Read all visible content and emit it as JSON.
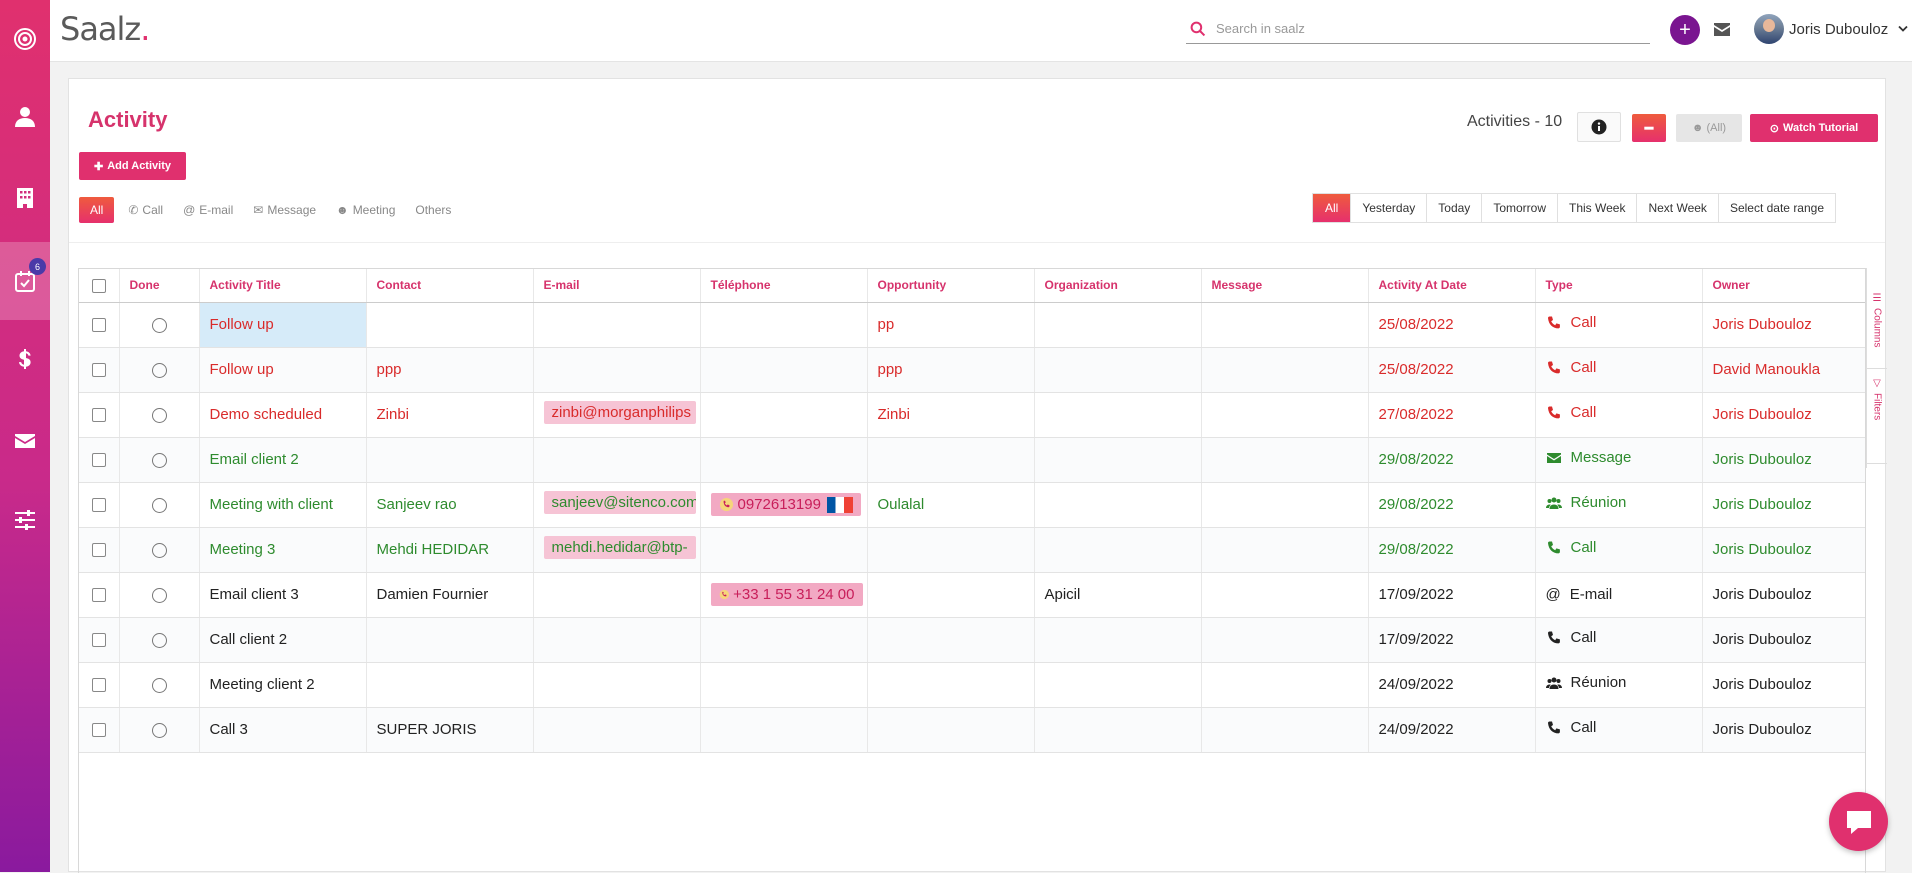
{
  "app": {
    "logo_prefix": "S",
    "logo_middle": "aalz",
    "logo_dot": "."
  },
  "sidebar": {
    "items": [
      {
        "icon": "target-icon"
      },
      {
        "icon": "user-icon"
      },
      {
        "icon": "building-icon"
      },
      {
        "icon": "calendar-check-icon",
        "badge": "6"
      },
      {
        "icon": "dollar-icon"
      },
      {
        "icon": "envelope-icon"
      },
      {
        "icon": "sliders-icon"
      }
    ]
  },
  "header": {
    "search_placeholder": "Search in saalz",
    "plus_label": "+",
    "user_name": "Joris Dubouloz"
  },
  "page": {
    "title": "Activity",
    "add_button": "Add Activity",
    "count_label": "Activities - 10",
    "owner_filter_label": "(All)",
    "tutorial_button": "Watch Tutorial"
  },
  "type_filters": [
    {
      "label": "All",
      "icon": ""
    },
    {
      "label": "Call",
      "icon": "phone-icon"
    },
    {
      "label": "E-mail",
      "icon": "at-icon"
    },
    {
      "label": "Message",
      "icon": "envelope-icon"
    },
    {
      "label": "Meeting",
      "icon": "users-icon"
    },
    {
      "label": "Others",
      "icon": ""
    }
  ],
  "date_filters": [
    "All",
    "Yesterday",
    "Today",
    "Tomorrow",
    "This Week",
    "Next Week",
    "Select date range"
  ],
  "table": {
    "columns": [
      "Done",
      "Activity Title",
      "Contact",
      "E-mail",
      "Téléphone",
      "Opportunity",
      "Organization",
      "Message",
      "Activity At Date",
      "Type",
      "Owner"
    ],
    "rows": [
      {
        "title": "Follow up",
        "contact": "",
        "email": "",
        "phone": "",
        "opportunity": "pp",
        "organization": "",
        "message": "",
        "date": "25/08/2022",
        "type": "Call",
        "owner": "Joris Dubouloz"
      },
      {
        "title": "Follow up",
        "contact": "ppp",
        "email": "",
        "phone": "",
        "opportunity": "ppp",
        "organization": "",
        "message": "",
        "date": "25/08/2022",
        "type": "Call",
        "owner": "David Manoukla"
      },
      {
        "title": "Demo scheduled",
        "contact": "Zinbi",
        "email": "zinbi@morganphilips",
        "phone": "",
        "opportunity": "Zinbi",
        "organization": "",
        "message": "",
        "date": "27/08/2022",
        "type": "Call",
        "owner": "Joris Dubouloz"
      },
      {
        "title": "Email client 2",
        "contact": "",
        "email": "",
        "phone": "",
        "opportunity": "",
        "organization": "",
        "message": "",
        "date": "29/08/2022",
        "type": "Message",
        "owner": "Joris Dubouloz"
      },
      {
        "title": "Meeting with client",
        "contact": "Sanjeev rao",
        "email": "sanjeev@sitenco.com",
        "phone": "0972613199",
        "opportunity": "Oulalal",
        "organization": "",
        "message": "",
        "date": "29/08/2022",
        "type": "Réunion",
        "owner": "Joris Dubouloz"
      },
      {
        "title": "Meeting 3",
        "contact": "Mehdi HEDIDAR",
        "email": "mehdi.hedidar@btp-",
        "phone": "",
        "opportunity": "",
        "organization": "",
        "message": "",
        "date": "29/08/2022",
        "type": "Call",
        "owner": "Joris Dubouloz"
      },
      {
        "title": "Email client 3",
        "contact": "Damien Fournier",
        "email": "",
        "phone": "+33 1 55 31 24 00",
        "opportunity": "",
        "organization": "Apicil",
        "message": "",
        "date": "17/09/2022",
        "type": "E-mail",
        "owner": "Joris Dubouloz"
      },
      {
        "title": "Call client 2",
        "contact": "",
        "email": "",
        "phone": "",
        "opportunity": "",
        "organization": "",
        "message": "",
        "date": "17/09/2022",
        "type": "Call",
        "owner": "Joris Dubouloz"
      },
      {
        "title": "Meeting client 2",
        "contact": "",
        "email": "",
        "phone": "",
        "opportunity": "",
        "organization": "",
        "message": "",
        "date": "24/09/2022",
        "type": "Réunion",
        "owner": "Joris Dubouloz"
      },
      {
        "title": "Call 3",
        "contact": "SUPER JORIS",
        "email": "",
        "phone": "",
        "opportunity": "",
        "organization": "",
        "message": "",
        "date": "24/09/2022",
        "type": "Call",
        "owner": "Joris Dubouloz"
      }
    ]
  },
  "side_tabs": [
    "Columns",
    "Filters"
  ],
  "colors": {
    "brand": "#e0306e",
    "overdue": "#d92b2b",
    "today": "#2e8b2e",
    "future": "#222222"
  }
}
